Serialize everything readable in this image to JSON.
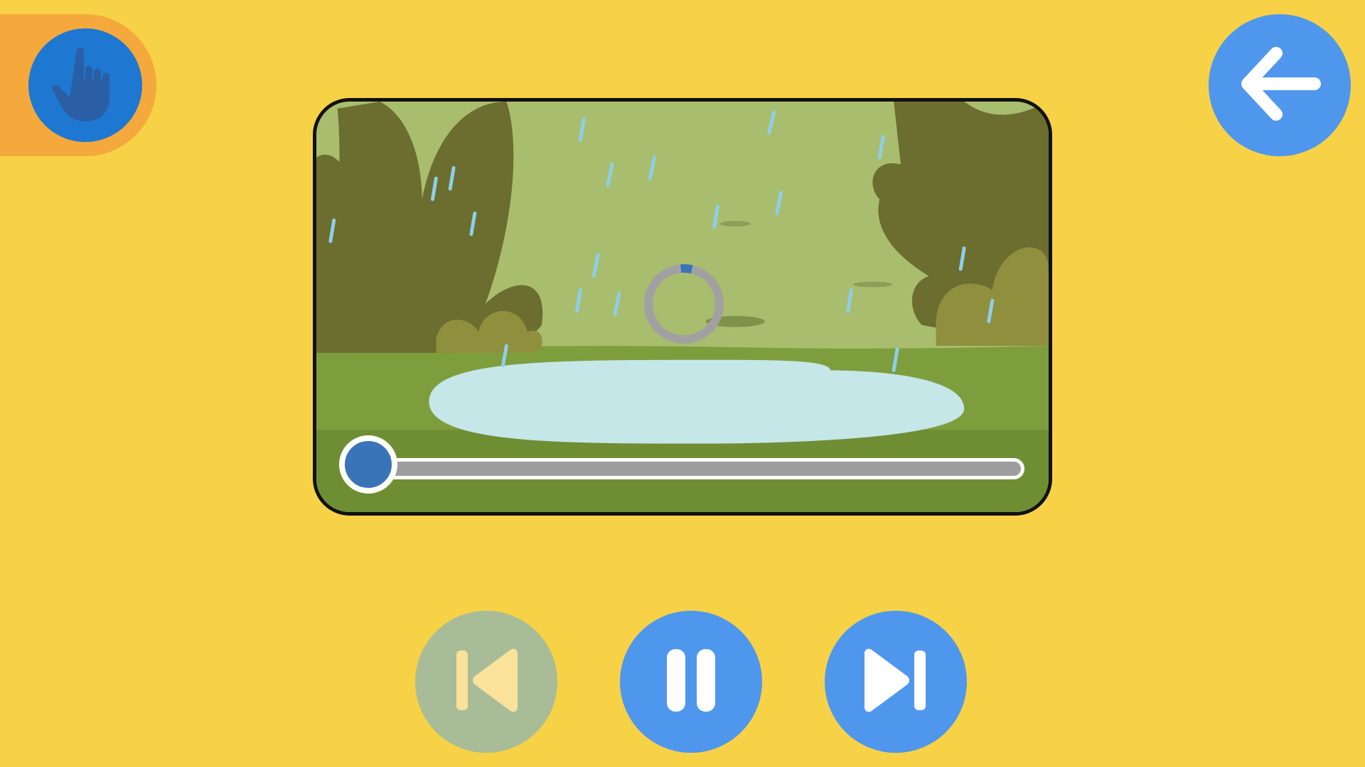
{
  "app": {
    "background_color": "#F7D247"
  },
  "mode_toggle": {
    "icon": "pointing-hand-icon",
    "tab_color": "#F5A93C",
    "button_color": "#1E78D2"
  },
  "back_button": {
    "icon": "arrow-left-icon",
    "color": "#4F97ED"
  },
  "video": {
    "scene": "rainy-puddle-scene",
    "loading": true,
    "loading_progress": 0.05,
    "playback_progress": 0.0
  },
  "controls": {
    "previous": {
      "icon": "skip-previous-icon",
      "enabled": false,
      "color": "#A8BC98"
    },
    "pause": {
      "icon": "pause-icon",
      "color": "#4F97ED"
    },
    "next": {
      "icon": "skip-next-icon",
      "enabled": true,
      "color": "#4F97ED"
    }
  }
}
